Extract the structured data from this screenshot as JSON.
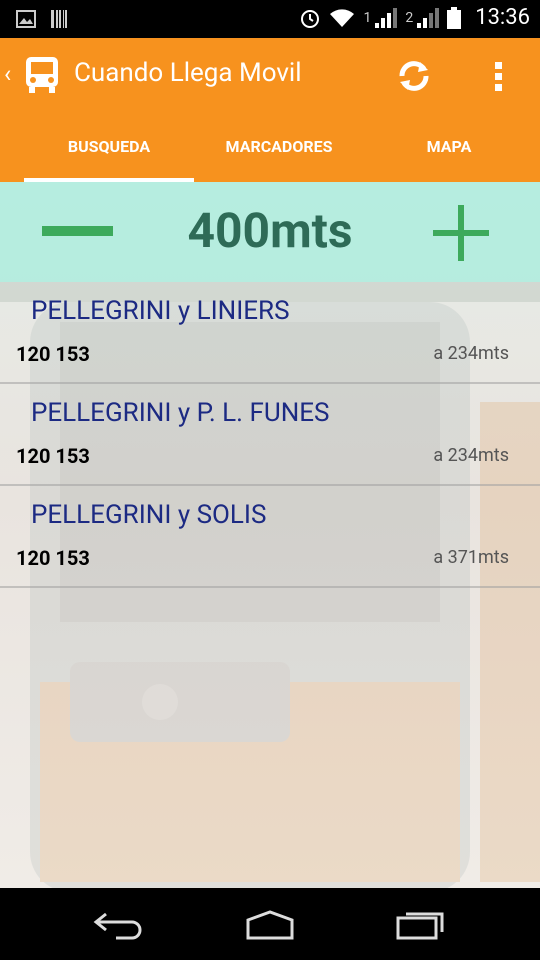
{
  "status_bar": {
    "time": "13:36",
    "sim1": "1",
    "sim2": "2"
  },
  "app_bar": {
    "title": "Cuando Llega Movil",
    "back_glyph": "‹",
    "icons": [
      "bus-icon",
      "refresh-icon",
      "overflow-menu-icon"
    ]
  },
  "tabs": [
    {
      "label": "BUSQUEDA",
      "active": true
    },
    {
      "label": "MARCADORES",
      "active": false
    },
    {
      "label": "MAPA",
      "active": false
    }
  ],
  "radius": {
    "value": "400mts"
  },
  "stops": [
    {
      "name": "PELLEGRINI y LINIERS",
      "lines": "120 153",
      "distance": "a 234mts"
    },
    {
      "name": "PELLEGRINI y P. L. FUNES",
      "lines": "120 153",
      "distance": "a 234mts"
    },
    {
      "name": "PELLEGRINI y SOLIS",
      "lines": "120 153",
      "distance": "a 371mts"
    }
  ],
  "colors": {
    "accent": "#f7921e",
    "radius_bar": "#b2f0e2",
    "stop_name": "#1c2a83",
    "control": "#3daa5c"
  }
}
